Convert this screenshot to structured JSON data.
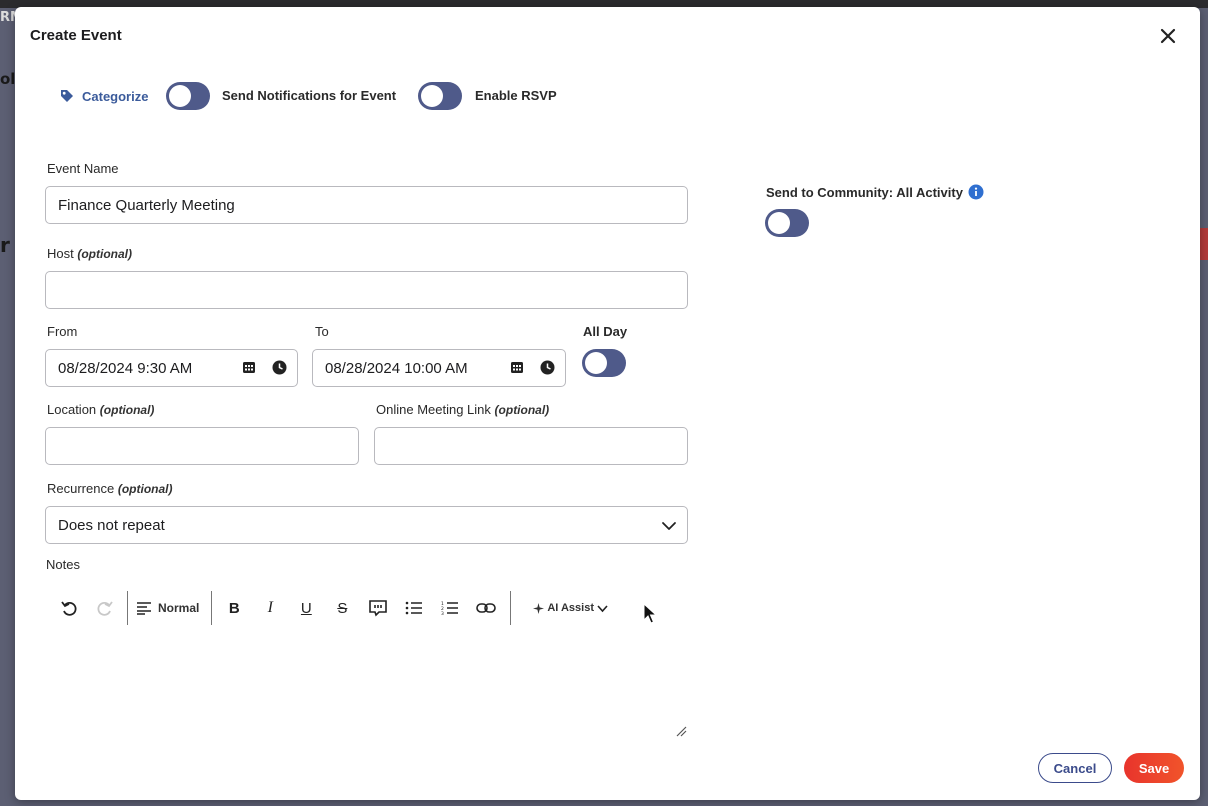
{
  "modal": {
    "title": "Create Event",
    "categorize_label": "Categorize",
    "send_notifications_label": "Send Notifications for Event",
    "enable_rsvp_label": "Enable RSVP"
  },
  "form": {
    "event_name": {
      "label": "Event Name",
      "value": "Finance Quarterly Meeting"
    },
    "host": {
      "label": "Host",
      "optional": "(optional)",
      "value": ""
    },
    "from": {
      "label": "From",
      "value": "08/28/2024 9:30 AM"
    },
    "to": {
      "label": "To",
      "value": "08/28/2024 10:00 AM"
    },
    "all_day": {
      "label": "All Day"
    },
    "location": {
      "label": "Location",
      "optional": "(optional)",
      "value": ""
    },
    "online_link": {
      "label": "Online Meeting Link",
      "optional": "(optional)",
      "value": ""
    },
    "recurrence": {
      "label": "Recurrence",
      "optional": "(optional)",
      "selected": "Does not repeat"
    },
    "notes": {
      "label": "Notes"
    }
  },
  "community": {
    "label": "Send to Community: All Activity"
  },
  "toolbar": {
    "style": "Normal",
    "ai_assist": "AI Assist"
  },
  "actions": {
    "cancel": "Cancel",
    "save": "Save"
  },
  "background": {
    "frag_top": "RM",
    "frag_mid": "ol",
    "frag_r": "r"
  },
  "colors": {
    "toggle": "#4f5a8a",
    "save": "#ea3a2c",
    "cancel_border": "#3b4b8b",
    "info": "#2f6fd0"
  }
}
